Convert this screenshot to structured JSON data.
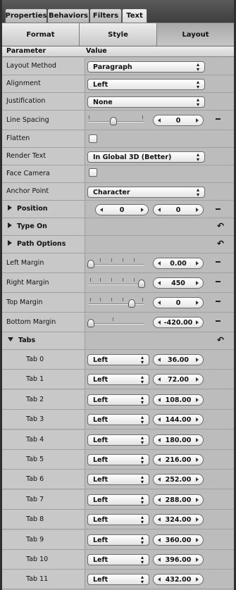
{
  "top_tabs": [
    {
      "label": "Properties",
      "active": false
    },
    {
      "label": "Behaviors",
      "active": false
    },
    {
      "label": "Filters",
      "active": false
    },
    {
      "label": "Text",
      "active": true
    }
  ],
  "segments": [
    {
      "label": "Format",
      "active": false
    },
    {
      "label": "Style",
      "active": false
    },
    {
      "label": "Layout",
      "active": true
    }
  ],
  "header": {
    "param": "Parameter",
    "value": "Value"
  },
  "rows": {
    "layout_method": {
      "label": "Layout Method",
      "value": "Paragraph"
    },
    "alignment": {
      "label": "Alignment",
      "value": "Left"
    },
    "justification": {
      "label": "Justification",
      "value": "None"
    },
    "line_spacing": {
      "label": "Line Spacing",
      "value": "0",
      "slider_level": 0.45
    },
    "flatten": {
      "label": "Flatten",
      "checked": false
    },
    "render_text": {
      "label": "Render Text",
      "value": "In Global 3D (Better)"
    },
    "face_camera": {
      "label": "Face Camera",
      "checked": false
    },
    "anchor_point": {
      "label": "Anchor Point",
      "value": "Character"
    },
    "position": {
      "label": "Position",
      "x": "0",
      "y": "0"
    },
    "type_on": {
      "label": "Type On"
    },
    "path_options": {
      "label": "Path Options"
    },
    "left_margin": {
      "label": "Left Margin",
      "value": "0.00",
      "slider_level": 0.0
    },
    "right_margin": {
      "label": "Right Margin",
      "value": "450",
      "slider_level": 1.0
    },
    "top_margin": {
      "label": "Top Margin",
      "value": "0",
      "slider_level": 0.8
    },
    "bottom_margin": {
      "label": "Bottom Margin",
      "value": "-420.00",
      "slider_level": 0.0
    },
    "tabs": {
      "label": "Tabs"
    }
  },
  "tabs": [
    {
      "label": "Tab 0",
      "align": "Left",
      "value": "36.00"
    },
    {
      "label": "Tab 1",
      "align": "Left",
      "value": "72.00"
    },
    {
      "label": "Tab 2",
      "align": "Left",
      "value": "108.00"
    },
    {
      "label": "Tab 3",
      "align": "Left",
      "value": "144.00"
    },
    {
      "label": "Tab 4",
      "align": "Left",
      "value": "180.00"
    },
    {
      "label": "Tab 5",
      "align": "Left",
      "value": "216.00"
    },
    {
      "label": "Tab 6",
      "align": "Left",
      "value": "252.00"
    },
    {
      "label": "Tab 7",
      "align": "Left",
      "value": "288.00"
    },
    {
      "label": "Tab 8",
      "align": "Left",
      "value": "324.00"
    },
    {
      "label": "Tab 9",
      "align": "Left",
      "value": "360.00"
    },
    {
      "label": "Tab 10",
      "align": "Left",
      "value": "396.00"
    },
    {
      "label": "Tab 11",
      "align": "Left",
      "value": "432.00"
    }
  ],
  "icons": {
    "reset": "reset-arrow-icon",
    "disclosure": "disclosure-triangle-icon",
    "minus": "minus-icon"
  }
}
